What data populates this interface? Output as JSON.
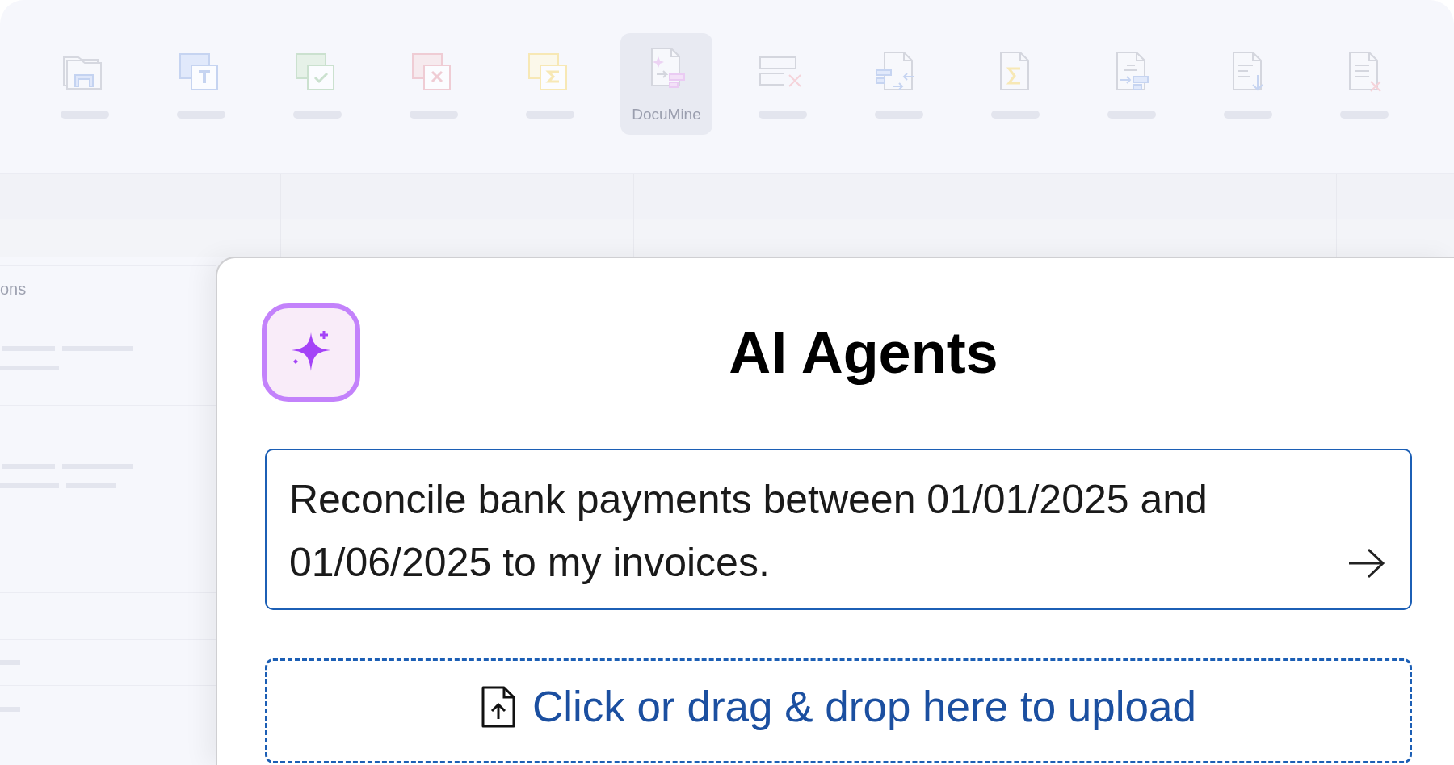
{
  "toolbar": {
    "items": [
      {
        "kind": "folder",
        "selected": false
      },
      {
        "kind": "text",
        "selected": false
      },
      {
        "kind": "check",
        "selected": false
      },
      {
        "kind": "cross",
        "selected": false
      },
      {
        "kind": "sum",
        "selected": false
      },
      {
        "kind": "documine",
        "label": "DocuMine",
        "selected": true
      },
      {
        "kind": "remove-row",
        "selected": false
      },
      {
        "kind": "doc-swap",
        "selected": false
      },
      {
        "kind": "doc-sum",
        "selected": false
      },
      {
        "kind": "doc-extract",
        "selected": false
      },
      {
        "kind": "doc-download",
        "selected": false
      },
      {
        "kind": "doc-delete",
        "selected": false
      }
    ]
  },
  "side_panel": {
    "header": "ons"
  },
  "dialog": {
    "title": "AI Agents",
    "prompt": {
      "value": "Reconcile bank payments between 01/01/2025 and 01/06/2025 to my invoices."
    },
    "upload": {
      "label": "Click or drag & drop here to upload"
    }
  }
}
